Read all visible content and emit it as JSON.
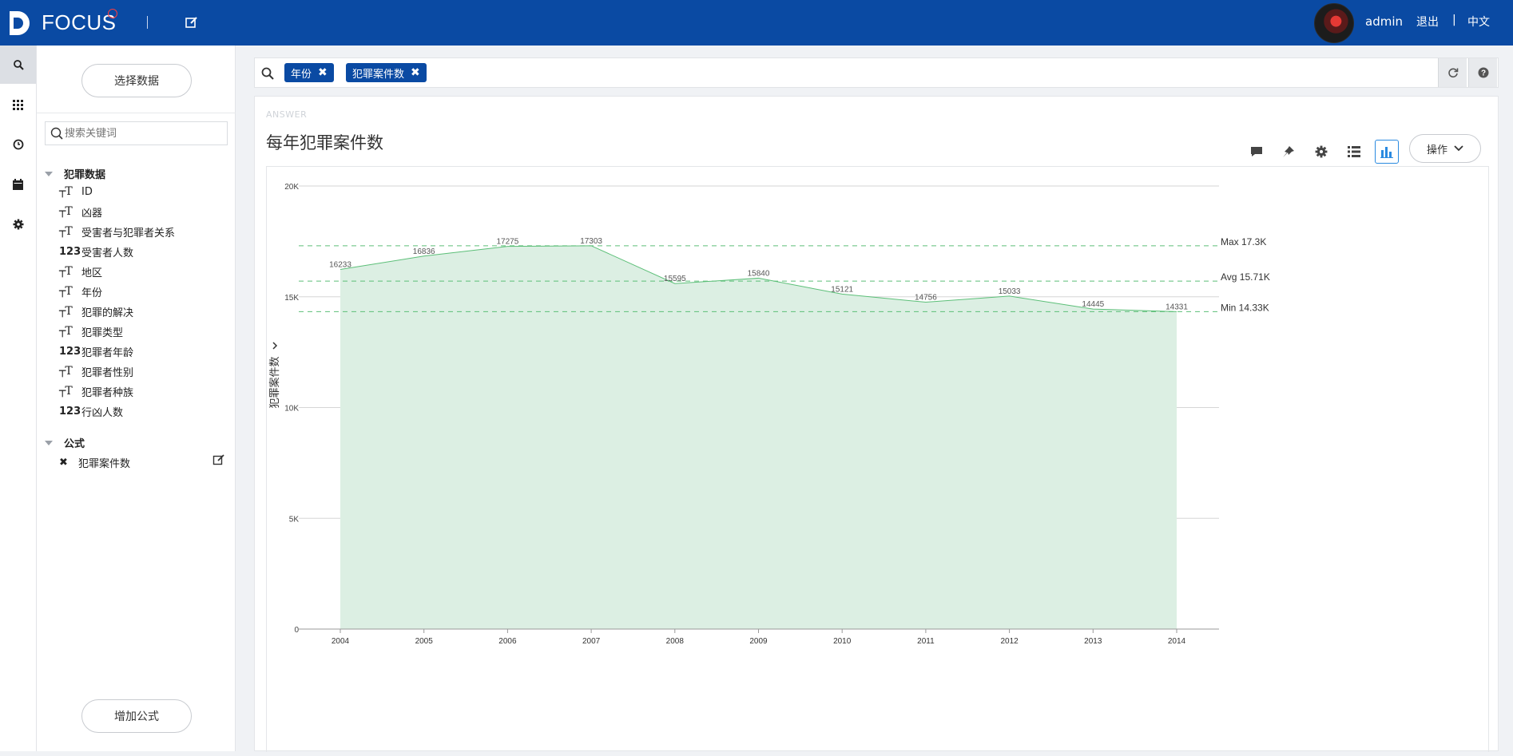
{
  "topbar": {
    "logo_text": "FOCUS",
    "user_name": "admin",
    "logout_label": "退出",
    "separator": "|",
    "language_label": "中文",
    "brand_color": "#0a4aa3"
  },
  "rail": {
    "items": [
      "search-icon",
      "grid-icon",
      "clock-icon",
      "calendar-icon",
      "gear-icon"
    ]
  },
  "sidebar": {
    "select_data_label": "选择数据",
    "search_placeholder": "搜索关键词",
    "dataset_name": "犯罪数据",
    "fields": [
      {
        "type": "T",
        "label": "ID"
      },
      {
        "type": "T",
        "label": "凶器"
      },
      {
        "type": "T",
        "label": "受害者与犯罪者关系"
      },
      {
        "type": "123",
        "label": "受害者人数"
      },
      {
        "type": "T",
        "label": "地区"
      },
      {
        "type": "T",
        "label": "年份"
      },
      {
        "type": "T",
        "label": "犯罪的解决"
      },
      {
        "type": "T",
        "label": "犯罪类型"
      },
      {
        "type": "123",
        "label": "犯罪者年龄"
      },
      {
        "type": "T",
        "label": "犯罪者性别"
      },
      {
        "type": "T",
        "label": "犯罪者种族"
      },
      {
        "type": "123",
        "label": "行凶人数"
      }
    ],
    "formula_group": "公式",
    "formula_item": "犯罪案件数",
    "add_formula_label": "增加公式"
  },
  "searchbar": {
    "chips": [
      "年份",
      "犯罪案件数"
    ]
  },
  "card": {
    "answer_label": "ANSWER",
    "title": "每年犯罪案件数",
    "ops_label": "操作"
  },
  "chart_data": {
    "type": "area",
    "x": [
      "2004",
      "2005",
      "2006",
      "2007",
      "2008",
      "2009",
      "2010",
      "2011",
      "2012",
      "2013",
      "2014"
    ],
    "values": [
      16233,
      16836,
      17275,
      17303,
      15595,
      15840,
      15121,
      14756,
      15033,
      14445,
      14331
    ],
    "ylabel": "犯罪案件数",
    "ylim": [
      0,
      20000
    ],
    "yticks": [
      0,
      5000,
      10000,
      15000,
      20000
    ],
    "ytick_labels": [
      "0",
      "5K",
      "10K",
      "15K",
      "20K"
    ],
    "reference_lines": [
      {
        "label": "Max 17.3K",
        "value": 17303
      },
      {
        "label": "Avg 15.71K",
        "value": 15707
      },
      {
        "label": "Min 14.33K",
        "value": 14331
      }
    ],
    "grid": true,
    "line_color": "#5cbf78",
    "fill_color": "#dcefe3"
  }
}
